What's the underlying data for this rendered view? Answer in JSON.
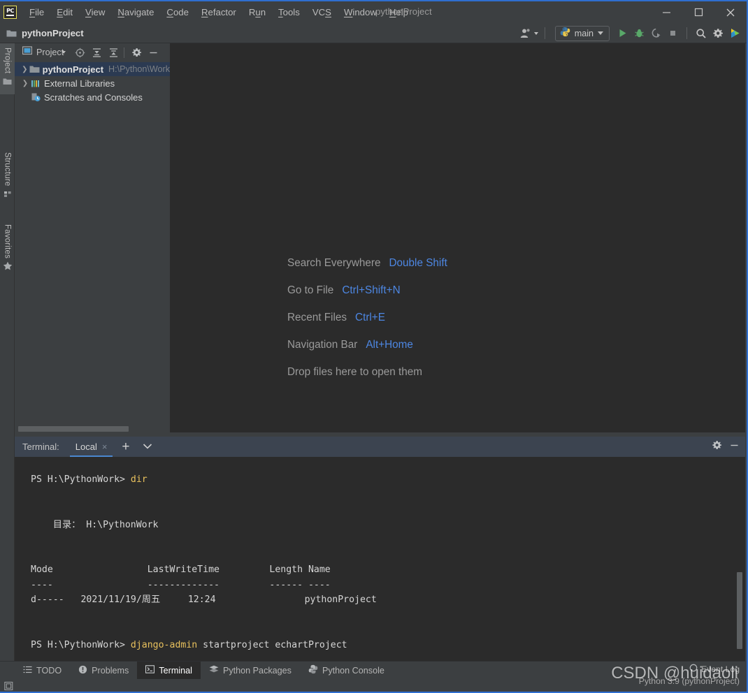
{
  "window": {
    "title": "pythonProject",
    "app_icon": "pycharm-logo-icon",
    "minimize_label": "Minimize",
    "maximize_label": "Maximize",
    "close_label": "Close"
  },
  "menu": {
    "items": [
      {
        "label": "File",
        "mnemonic": "F"
      },
      {
        "label": "Edit",
        "mnemonic": "E"
      },
      {
        "label": "View",
        "mnemonic": "V"
      },
      {
        "label": "Navigate",
        "mnemonic": "N"
      },
      {
        "label": "Code",
        "mnemonic": "C"
      },
      {
        "label": "Refactor",
        "mnemonic": "R"
      },
      {
        "label": "Run",
        "mnemonic": "u"
      },
      {
        "label": "Tools",
        "mnemonic": "T"
      },
      {
        "label": "VCS",
        "mnemonic": "S"
      },
      {
        "label": "Window",
        "mnemonic": "W"
      },
      {
        "label": "Help",
        "mnemonic": "H"
      }
    ]
  },
  "toolbar": {
    "project_name": "pythonProject",
    "folder_icon": "folder-icon",
    "account_icon": "user-account-icon",
    "run_config": {
      "label": "main",
      "icon": "python-icon"
    },
    "run_icon": "run-play-icon",
    "debug_icon": "debug-bug-icon",
    "coverage_icon": "run-with-coverage-icon",
    "stop_icon": "stop-square-icon",
    "search_icon": "search-icon",
    "settings_icon": "gear-icon",
    "updates_icon": "ide-updates-icon"
  },
  "left_rail": {
    "tabs": [
      {
        "label": "Project",
        "icon": "project-folder-icon",
        "active": true
      },
      {
        "label": "Structure",
        "icon": "structure-icon",
        "active": false
      },
      {
        "label": "Favorites",
        "icon": "star-icon",
        "active": false
      }
    ]
  },
  "project_panel": {
    "title": "Project",
    "tools": [
      {
        "name": "select-opened-file-icon",
        "glyph": "target"
      },
      {
        "name": "expand-all-icon",
        "glyph": "expand"
      },
      {
        "name": "collapse-all-icon",
        "glyph": "collapse"
      },
      {
        "name": "panel-settings-icon",
        "glyph": "gear"
      },
      {
        "name": "hide-panel-icon",
        "glyph": "minus"
      }
    ],
    "tree": [
      {
        "label": "pythonProject",
        "path": "H:\\Python\\Work",
        "icon": "module-folder-icon",
        "arrow": "chevron-right",
        "bold": true,
        "selected": true,
        "indent": 0
      },
      {
        "label": "External Libraries",
        "path": "",
        "icon": "external-libraries-icon",
        "arrow": "chevron-right",
        "bold": false,
        "selected": false,
        "indent": 0
      },
      {
        "label": "Scratches and Consoles",
        "path": "",
        "icon": "scratches-icon",
        "arrow": "",
        "bold": false,
        "selected": false,
        "indent": 0
      }
    ]
  },
  "editor": {
    "hints": [
      {
        "label": "Search Everywhere",
        "key": "Double Shift"
      },
      {
        "label": "Go to File",
        "key": "Ctrl+Shift+N"
      },
      {
        "label": "Recent Files",
        "key": "Ctrl+E"
      },
      {
        "label": "Navigation Bar",
        "key": "Alt+Home"
      },
      {
        "label": "Drop files here to open them",
        "key": ""
      }
    ]
  },
  "terminal": {
    "header_label": "Terminal:",
    "tab_label": "Local",
    "close_glyph": "×",
    "add_tab_glyph": "+",
    "dropdown_icon": "chevron-down-icon",
    "settings_icon": "gear-icon",
    "hide_icon": "hide-panel-icon",
    "lines": [
      {
        "prompt": "PS H:\\PythonWork> ",
        "cmd": "dir",
        "args": ""
      },
      {
        "prompt": "",
        "cmd": "",
        "args": ""
      },
      {
        "prompt": "",
        "cmd": "",
        "args": ""
      },
      {
        "prompt": "",
        "cmd": "",
        "args": "    目录： H:\\PythonWork"
      },
      {
        "prompt": "",
        "cmd": "",
        "args": ""
      },
      {
        "prompt": "",
        "cmd": "",
        "args": ""
      },
      {
        "prompt": "",
        "cmd": "",
        "args": "Mode                 LastWriteTime         Length Name"
      },
      {
        "prompt": "",
        "cmd": "",
        "args": "----                 -------------         ------ ----"
      },
      {
        "prompt": "",
        "cmd": "",
        "args": "d-----   2021/11/19/周五     12:24                pythonProject"
      },
      {
        "prompt": "",
        "cmd": "",
        "args": ""
      },
      {
        "prompt": "",
        "cmd": "",
        "args": ""
      },
      {
        "prompt": "PS H:\\PythonWork> ",
        "cmd": "django-admin",
        "args": " startproject echartProject"
      }
    ]
  },
  "statusbar": {
    "tabs": [
      {
        "label": "TODO",
        "icon": "todo-list-icon",
        "active": false
      },
      {
        "label": "Problems",
        "icon": "problems-warning-icon",
        "active": false
      },
      {
        "label": "Terminal",
        "icon": "terminal-icon",
        "active": true
      },
      {
        "label": "Python Packages",
        "icon": "python-packages-icon",
        "active": false
      },
      {
        "label": "Python Console",
        "icon": "python-console-icon",
        "active": false
      }
    ],
    "event_log": {
      "label": "Event Log",
      "icon": "event-log-icon"
    },
    "interpreter": "Python 3.9 (pythonProject)",
    "layout_icon": "layout-settings-icon"
  },
  "watermark": {
    "text": "CSDN @huidaoli"
  },
  "colors": {
    "accent_blue": "#4d87e3",
    "window_border": "#2f6fd0",
    "panel_bg": "#3c3f41",
    "editor_bg": "#2b2b2b",
    "terminal_tabbar_bg": "#3c4450",
    "selected_row_bg": "#2b3a52",
    "terminal_cmd": "#e8c15d"
  }
}
